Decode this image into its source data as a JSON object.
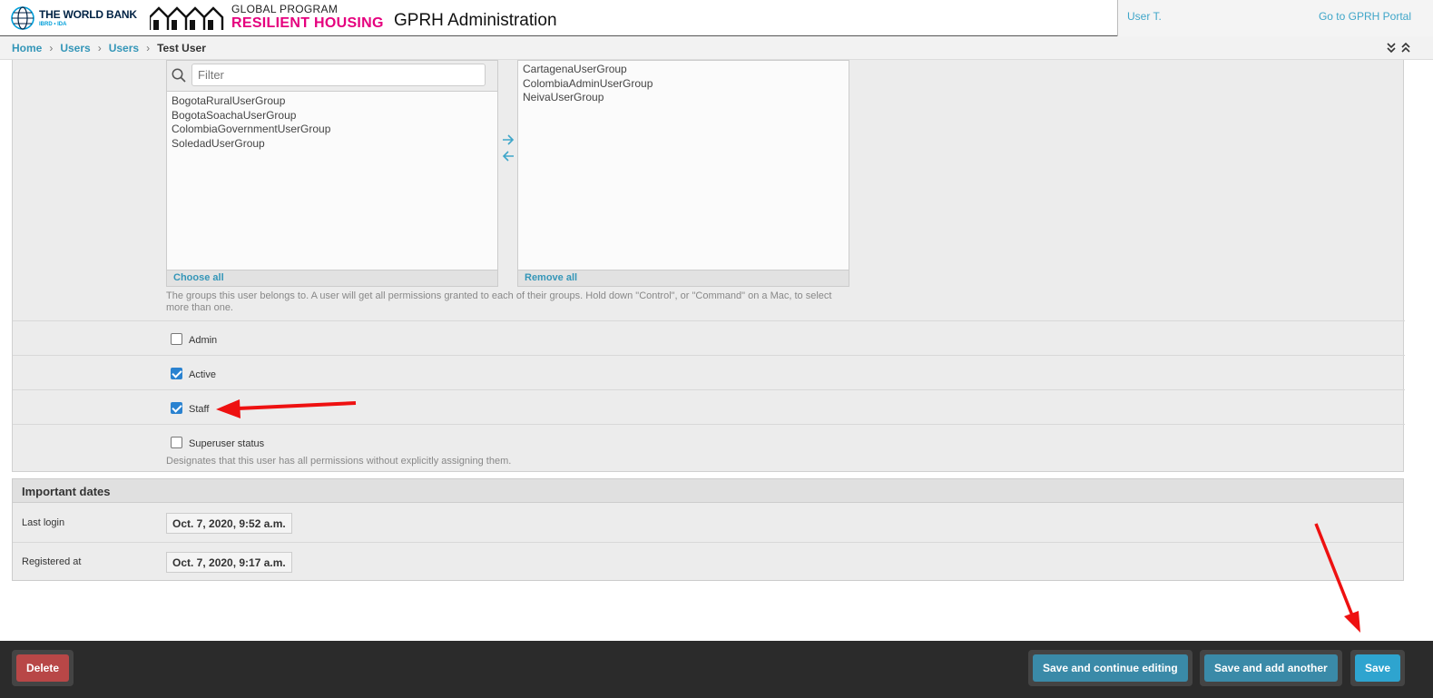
{
  "header": {
    "wb_name": "THE WORLD BANK",
    "wb_sub": "IBRD • IDA",
    "gprh_line1": "GLOBAL PROGRAM",
    "gprh_line2": "RESILIENT HOUSING",
    "title": "GPRH Administration",
    "user": "User T.",
    "portal_link": "Go to GPRH Portal"
  },
  "breadcrumbs": [
    {
      "label": "Home"
    },
    {
      "label": "Users"
    },
    {
      "label": "Users"
    },
    {
      "label": "Test User"
    }
  ],
  "groups": {
    "filter_placeholder": "Filter",
    "available": [
      "BogotaRuralUserGroup",
      "BogotaSoachaUserGroup",
      "ColombiaGovernmentUserGroup",
      "SoledadUserGroup"
    ],
    "chosen": [
      "CartagenaUserGroup",
      "ColombiaAdminUserGroup",
      "NeivaUserGroup"
    ],
    "choose_all": "Choose all",
    "remove_all": "Remove all",
    "help_line1": "The groups this user belongs to. A user will get all permissions granted to each of their groups. Hold down \"Control\", or \"Command\" on a Mac, to select",
    "help_line2": "more than one."
  },
  "flags": {
    "admin": {
      "label": "Admin",
      "checked": false
    },
    "active": {
      "label": "Active",
      "checked": true
    },
    "staff": {
      "label": "Staff",
      "checked": true
    },
    "superuser": {
      "label": "Superuser status",
      "checked": false,
      "help": "Designates that this user has all permissions without explicitly assigning them."
    }
  },
  "dates": {
    "heading": "Important dates",
    "last_login_label": "Last login",
    "last_login": "Oct. 7, 2020, 9:52 a.m.",
    "registered_label": "Registered at",
    "registered": "Oct. 7, 2020, 9:17 a.m."
  },
  "submit": {
    "delete": "Delete",
    "save_continue": "Save and continue editing",
    "save_add": "Save and add another",
    "save": "Save"
  },
  "colors": {
    "link": "#3496b8",
    "brand_pink": "#e5007e",
    "annotation_arrow": "#ee1111",
    "delete_red": "#b84747",
    "save_blue": "#2ea4cf"
  }
}
